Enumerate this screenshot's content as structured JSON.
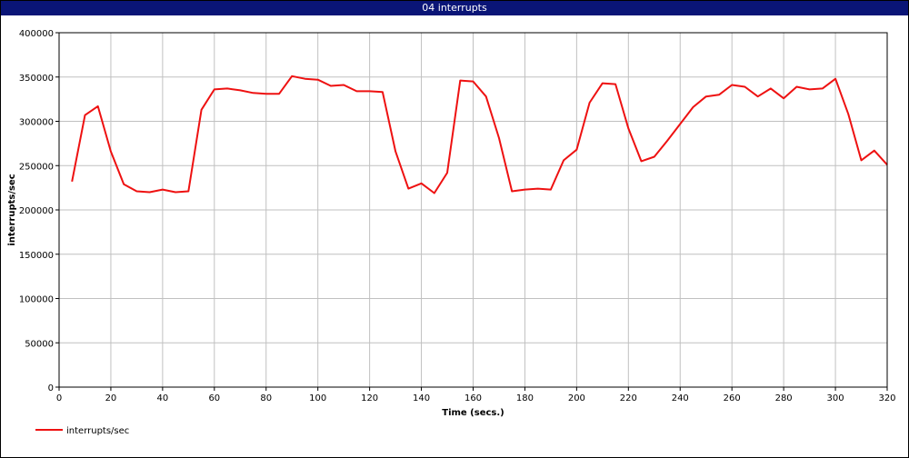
{
  "window": {
    "title": "04 interrupts"
  },
  "colors": {
    "titlebar": "#0a1577",
    "series": "#ee1111",
    "grid": "#c0c0c0"
  },
  "chart_data": {
    "type": "line",
    "title": "04 interrupts",
    "xlabel": "Time (secs.)",
    "ylabel": "interrupts/sec",
    "xlim": [
      0,
      320
    ],
    "ylim": [
      0,
      400000
    ],
    "xticks": [
      0,
      20,
      40,
      60,
      80,
      100,
      120,
      140,
      160,
      180,
      200,
      220,
      240,
      260,
      280,
      300,
      320
    ],
    "yticks": [
      0,
      50000,
      100000,
      150000,
      200000,
      250000,
      300000,
      350000,
      400000
    ],
    "grid": true,
    "legend_position": "bottom-left",
    "series": [
      {
        "name": "interrupts/sec",
        "color": "#ee1111",
        "x": [
          5,
          10,
          15,
          20,
          25,
          30,
          35,
          40,
          45,
          50,
          55,
          60,
          65,
          70,
          75,
          80,
          85,
          90,
          95,
          100,
          105,
          110,
          115,
          120,
          125,
          130,
          135,
          140,
          145,
          150,
          155,
          160,
          165,
          170,
          175,
          180,
          185,
          190,
          195,
          200,
          205,
          210,
          215,
          220,
          225,
          230,
          235,
          240,
          245,
          250,
          255,
          260,
          265,
          270,
          275,
          280,
          285,
          290,
          295,
          300,
          305,
          310,
          315,
          320
        ],
        "y": [
          232000,
          307000,
          317000,
          266000,
          229000,
          221000,
          220000,
          223000,
          220000,
          221000,
          313000,
          336000,
          337000,
          335000,
          332000,
          331000,
          331000,
          351000,
          348000,
          347000,
          340000,
          341000,
          334000,
          334000,
          333000,
          266000,
          224000,
          230000,
          219000,
          242000,
          346000,
          345000,
          328000,
          281000,
          221000,
          223000,
          224000,
          223000,
          256000,
          268000,
          321000,
          343000,
          342000,
          292000,
          255000,
          260000,
          278000,
          297000,
          316000,
          328000,
          330000,
          341000,
          339000,
          328000,
          337000,
          326000,
          339000,
          336000,
          337000,
          348000,
          308000,
          256000,
          267000,
          251000
        ]
      }
    ]
  }
}
